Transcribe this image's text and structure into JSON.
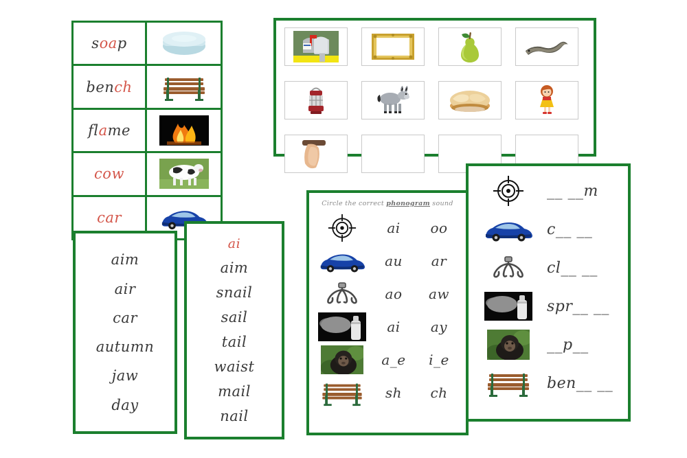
{
  "theme": {
    "card_border_color": "#1b7f2e",
    "highlight_color": "#d4564a",
    "page_background": "#ffffff"
  },
  "word_picture_card": {
    "rows": [
      {
        "word_prefix": "s",
        "word_highlight": "oa",
        "word_suffix": "p",
        "word_full": "soap",
        "picture": "soap-bar-image"
      },
      {
        "word_prefix": "ben",
        "word_highlight": "ch",
        "word_suffix": "",
        "word_full": "bench",
        "picture": "park-bench-image"
      },
      {
        "word_prefix": "fl",
        "word_highlight": "a",
        "word_suffix": "me",
        "word_full": "flame",
        "picture": "fire-flame-image"
      },
      {
        "word_prefix": "",
        "word_highlight": "cow",
        "word_suffix": "",
        "word_full": "cow",
        "picture": "cow-image"
      },
      {
        "word_prefix": "",
        "word_highlight": "car",
        "word_suffix": "",
        "word_full": "car",
        "picture": "blue-car-image"
      }
    ]
  },
  "word_list_card": {
    "words": [
      "aim",
      "air",
      "car",
      "autumn",
      "jaw",
      "day"
    ]
  },
  "ai_list_card": {
    "heading": "ai",
    "words": [
      "aim",
      "snail",
      "sail",
      "tail",
      "waist",
      "mail",
      "nail"
    ]
  },
  "picture_grid_card": {
    "rows": [
      [
        "mailbox-image",
        "picture-frame-image",
        "pear-image",
        "eel-image"
      ],
      [
        "lantern-image",
        "donkey-image",
        "pie-image",
        "girl-image"
      ],
      [
        "hand-image",
        "blank-image",
        "blank-image",
        "blank-image"
      ]
    ]
  },
  "worksheet_card": {
    "title_before": "Circle the correct ",
    "title_bold": "phonogram",
    "title_after": " sound",
    "rows": [
      {
        "picture": "target-image",
        "option_left": "ai",
        "option_right": "oo"
      },
      {
        "picture": "blue-car-image",
        "option_left": "au",
        "option_right": "ar"
      },
      {
        "picture": "claw-image",
        "option_left": "ao",
        "option_right": "aw"
      },
      {
        "picture": "spray-image",
        "option_left": "ai",
        "option_right": "ay"
      },
      {
        "picture": "ape-image",
        "option_left": "a_e",
        "option_right": "i_e"
      },
      {
        "picture": "park-bench-image",
        "option_left": "sh",
        "option_right": "ch"
      }
    ]
  },
  "fill_in_card": {
    "rows": [
      {
        "picture": "target-image",
        "answer": "__ __m"
      },
      {
        "picture": "blue-car-image",
        "answer": "c__ __"
      },
      {
        "picture": "claw-image",
        "answer": "cl__ __"
      },
      {
        "picture": "spray-image",
        "answer": "spr__ __"
      },
      {
        "picture": "ape-image",
        "answer": "__p__"
      },
      {
        "picture": "park-bench-image",
        "answer": "ben__ __"
      }
    ]
  }
}
